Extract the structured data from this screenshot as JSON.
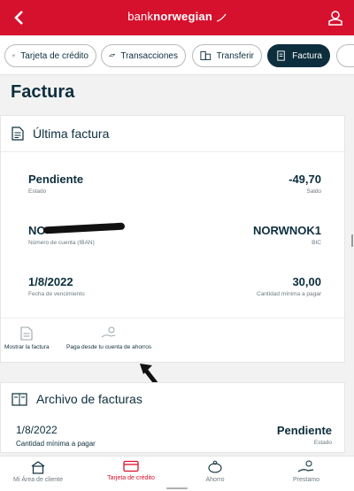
{
  "header": {
    "brand_prefix": "bank",
    "brand_name": "norwegian",
    "accent": "#d6112d"
  },
  "tabs": [
    {
      "label": "Tarjeta de crédito",
      "icon": "card-icon",
      "active": false
    },
    {
      "label": "Transacciones",
      "icon": "transactions-icon",
      "active": false
    },
    {
      "label": "Transferir",
      "icon": "transfer-icon",
      "active": false
    },
    {
      "label": "Factura",
      "icon": "invoice-icon",
      "active": true
    }
  ],
  "page_title": "Factura",
  "latest_invoice": {
    "heading": "Última factura",
    "status_value": "Pendiente",
    "status_label": "Estado",
    "balance_value": "-49,70",
    "balance_label": "Saldo",
    "account_value": "NO",
    "account_label": "Número de cuenta (IBAN)",
    "bic_value": "NORWNOK1",
    "bic_label": "BIC",
    "due_value": "1/8/2022",
    "due_label": "Fecha de vencimiento",
    "min_value": "30,00",
    "min_label": "Cantidad mínima a pagar",
    "actions": {
      "show_invoice": "Mostrar la factura",
      "pay_from_savings": "Paga desde tu cuenta de ahorros"
    }
  },
  "archive": {
    "heading": "Archivo de facturas",
    "date_value": "1/8/2022",
    "amount_label": "Cantidad mínima a pagar",
    "status_value": "Pendiente",
    "status_label": "Estado"
  },
  "bottom_nav": [
    {
      "label": "Mi Área de cliente",
      "icon": "home-icon",
      "active": false
    },
    {
      "label": "Tarjeta de crédito",
      "icon": "card-icon",
      "active": true
    },
    {
      "label": "Ahorro",
      "icon": "piggy-bank-icon",
      "active": false
    },
    {
      "label": "Prestamo",
      "icon": "loan-icon",
      "active": false
    }
  ]
}
